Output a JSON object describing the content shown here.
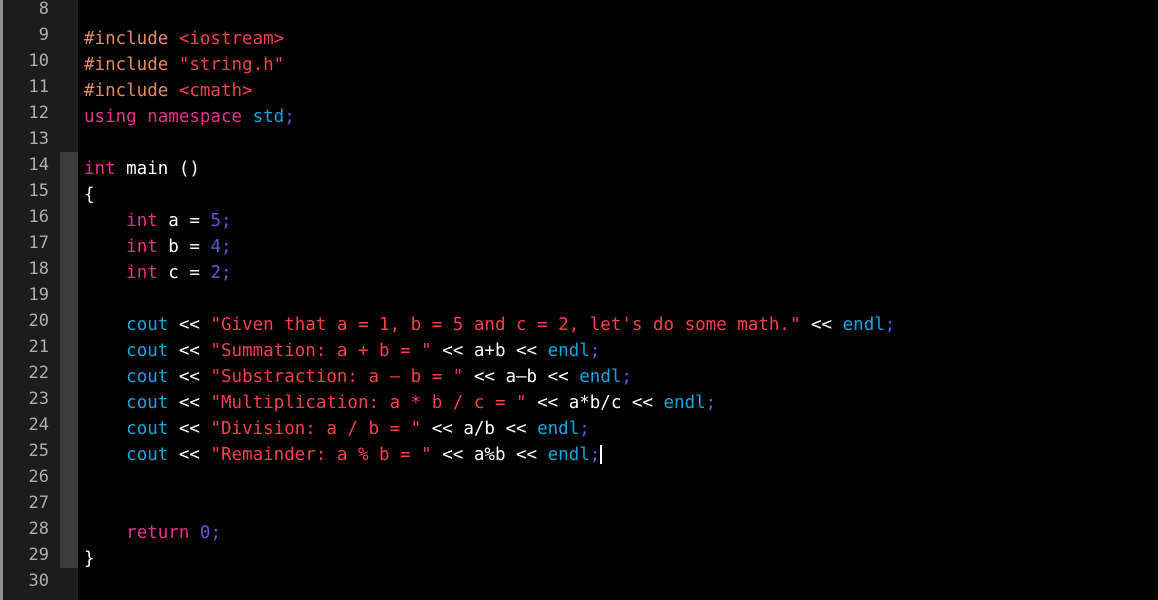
{
  "editor": {
    "language": "C++",
    "first_visible_line": 8,
    "last_visible_line": 30,
    "cursor_line": 25,
    "colors": {
      "background": "#000000",
      "gutter_background": "#1c1c1c",
      "line_number": "#aeaeae",
      "fold_active": "#3c3c3c",
      "preprocessor": "#e28b62",
      "string": "#f4404a",
      "keyword": "#e8308a",
      "type": "#14a5e0",
      "number": "#5b5bd6",
      "plain": "#ffffff",
      "caret": "#ffffff"
    }
  },
  "gutter": {
    "line_numbers": [
      8,
      9,
      10,
      11,
      12,
      13,
      14,
      15,
      16,
      17,
      18,
      19,
      20,
      21,
      22,
      23,
      24,
      25,
      26,
      27,
      28,
      29,
      30
    ]
  },
  "code": {
    "lines": [
      {
        "number": 8,
        "text": ""
      },
      {
        "number": 9,
        "text": "#include <iostream>"
      },
      {
        "number": 10,
        "text": "#include \"string.h\""
      },
      {
        "number": 11,
        "text": "#include <cmath>"
      },
      {
        "number": 12,
        "text": "using namespace std;"
      },
      {
        "number": 13,
        "text": ""
      },
      {
        "number": 14,
        "text": "int main ()"
      },
      {
        "number": 15,
        "text": "{"
      },
      {
        "number": 16,
        "text": "    int a = 5;"
      },
      {
        "number": 17,
        "text": "    int b = 4;"
      },
      {
        "number": 18,
        "text": "    int c = 2;"
      },
      {
        "number": 19,
        "text": ""
      },
      {
        "number": 20,
        "text": "    cout << \"Given that a = 1, b = 5 and c = 2, let's do some math.\" << endl;"
      },
      {
        "number": 21,
        "text": "    cout << \"Summation: a + b = \" << a+b << endl;"
      },
      {
        "number": 22,
        "text": "    cout << \"Substraction: a – b = \" << a–b << endl;"
      },
      {
        "number": 23,
        "text": "    cout << \"Multiplication: a * b / c = \" << a*b/c << endl;"
      },
      {
        "number": 24,
        "text": "    cout << \"Division: a / b = \" << a/b << endl;"
      },
      {
        "number": 25,
        "text": "    cout << \"Remainder: a % b = \" << a%b << endl;"
      },
      {
        "number": 26,
        "text": ""
      },
      {
        "number": 27,
        "text": ""
      },
      {
        "number": 28,
        "text": "    return 0;"
      },
      {
        "number": 29,
        "text": "}"
      },
      {
        "number": 30,
        "text": ""
      }
    ],
    "tokens": {
      "l9": [
        {
          "t": "#include ",
          "c": "t-pre"
        },
        {
          "t": "<iostream>",
          "c": "t-str"
        }
      ],
      "l10": [
        {
          "t": "#include ",
          "c": "t-pre"
        },
        {
          "t": "\"string.h\"",
          "c": "t-str"
        }
      ],
      "l11": [
        {
          "t": "#include ",
          "c": "t-pre"
        },
        {
          "t": "<cmath>",
          "c": "t-str"
        }
      ],
      "l12": [
        {
          "t": "using namespace ",
          "c": "t-kw"
        },
        {
          "t": "std",
          "c": "t-type"
        },
        {
          "t": ";",
          "c": "t-num"
        }
      ],
      "l14": [
        {
          "t": "int",
          "c": "t-kw"
        },
        {
          "t": " main ()",
          "c": "t-plain"
        }
      ],
      "l15": [
        {
          "t": "{",
          "c": "t-plain"
        }
      ],
      "l16": [
        {
          "t": "    ",
          "c": "t-plain"
        },
        {
          "t": "int",
          "c": "t-kw"
        },
        {
          "t": " a = ",
          "c": "t-plain"
        },
        {
          "t": "5",
          "c": "t-num"
        },
        {
          "t": ";",
          "c": "t-num"
        }
      ],
      "l17": [
        {
          "t": "    ",
          "c": "t-plain"
        },
        {
          "t": "int",
          "c": "t-kw"
        },
        {
          "t": " b = ",
          "c": "t-plain"
        },
        {
          "t": "4",
          "c": "t-num"
        },
        {
          "t": ";",
          "c": "t-num"
        }
      ],
      "l18": [
        {
          "t": "    ",
          "c": "t-plain"
        },
        {
          "t": "int",
          "c": "t-kw"
        },
        {
          "t": " c = ",
          "c": "t-plain"
        },
        {
          "t": "2",
          "c": "t-num"
        },
        {
          "t": ";",
          "c": "t-num"
        }
      ],
      "l20": [
        {
          "t": "    ",
          "c": "t-plain"
        },
        {
          "t": "cout",
          "c": "t-type"
        },
        {
          "t": " << ",
          "c": "t-plain"
        },
        {
          "t": "\"Given that a = 1, b = 5 and c = 2, let's do some math.\"",
          "c": "t-str"
        },
        {
          "t": " << ",
          "c": "t-plain"
        },
        {
          "t": "endl",
          "c": "t-type"
        },
        {
          "t": ";",
          "c": "t-num"
        }
      ],
      "l21": [
        {
          "t": "    ",
          "c": "t-plain"
        },
        {
          "t": "cout",
          "c": "t-type"
        },
        {
          "t": " << ",
          "c": "t-plain"
        },
        {
          "t": "\"Summation: a + b = \"",
          "c": "t-str"
        },
        {
          "t": " << a+b << ",
          "c": "t-plain"
        },
        {
          "t": "endl",
          "c": "t-type"
        },
        {
          "t": ";",
          "c": "t-num"
        }
      ],
      "l22": [
        {
          "t": "    ",
          "c": "t-plain"
        },
        {
          "t": "cout",
          "c": "t-type"
        },
        {
          "t": " << ",
          "c": "t-plain"
        },
        {
          "t": "\"Substraction: a – b = \"",
          "c": "t-str"
        },
        {
          "t": " << a–b << ",
          "c": "t-plain"
        },
        {
          "t": "endl",
          "c": "t-type"
        },
        {
          "t": ";",
          "c": "t-num"
        }
      ],
      "l23": [
        {
          "t": "    ",
          "c": "t-plain"
        },
        {
          "t": "cout",
          "c": "t-type"
        },
        {
          "t": " << ",
          "c": "t-plain"
        },
        {
          "t": "\"Multiplication: a * b / c = \"",
          "c": "t-str"
        },
        {
          "t": " << a*b/c << ",
          "c": "t-plain"
        },
        {
          "t": "endl",
          "c": "t-type"
        },
        {
          "t": ";",
          "c": "t-num"
        }
      ],
      "l24": [
        {
          "t": "    ",
          "c": "t-plain"
        },
        {
          "t": "cout",
          "c": "t-type"
        },
        {
          "t": " << ",
          "c": "t-plain"
        },
        {
          "t": "\"Division: a / b = \"",
          "c": "t-str"
        },
        {
          "t": " << a/b << ",
          "c": "t-plain"
        },
        {
          "t": "endl",
          "c": "t-type"
        },
        {
          "t": ";",
          "c": "t-num"
        }
      ],
      "l25": [
        {
          "t": "    ",
          "c": "t-plain"
        },
        {
          "t": "cout",
          "c": "t-type"
        },
        {
          "t": " << ",
          "c": "t-plain"
        },
        {
          "t": "\"Remainder: a % b = \"",
          "c": "t-str"
        },
        {
          "t": " << a%b << ",
          "c": "t-plain"
        },
        {
          "t": "endl",
          "c": "t-type"
        },
        {
          "t": ";",
          "c": "t-num"
        }
      ],
      "l28": [
        {
          "t": "    ",
          "c": "t-plain"
        },
        {
          "t": "return",
          "c": "t-kw"
        },
        {
          "t": " ",
          "c": "t-plain"
        },
        {
          "t": "0",
          "c": "t-num"
        },
        {
          "t": ";",
          "c": "t-num"
        }
      ],
      "l29": [
        {
          "t": "}",
          "c": "t-plain"
        }
      ]
    }
  }
}
